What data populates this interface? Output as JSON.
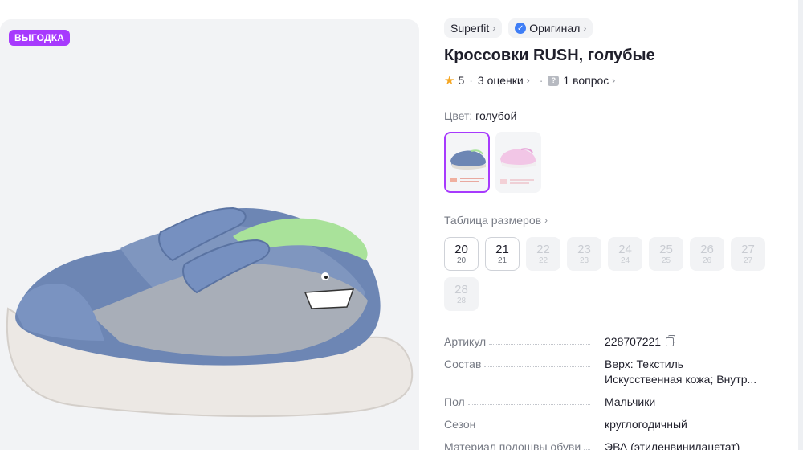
{
  "gallery": {
    "badge": "ВЫГОДКА"
  },
  "chips": {
    "brand": "Superfit",
    "original": "Оригинал"
  },
  "product": {
    "title": "Кроссовки RUSH, голубые"
  },
  "rating": {
    "score": "5",
    "reviews": "3 оценки",
    "questions": "1 вопрос"
  },
  "color": {
    "label": "Цвет:",
    "value": "голубой"
  },
  "sizes": {
    "label": "Таблица размеров",
    "items": [
      {
        "main": "20",
        "sub": "20",
        "available": true
      },
      {
        "main": "21",
        "sub": "21",
        "available": true
      },
      {
        "main": "22",
        "sub": "22",
        "available": false
      },
      {
        "main": "23",
        "sub": "23",
        "available": false
      },
      {
        "main": "24",
        "sub": "24",
        "available": false
      },
      {
        "main": "25",
        "sub": "25",
        "available": false
      },
      {
        "main": "26",
        "sub": "26",
        "available": false
      },
      {
        "main": "27",
        "sub": "27",
        "available": false
      },
      {
        "main": "28",
        "sub": "28",
        "available": false
      }
    ]
  },
  "specs": [
    {
      "key": "Артикул",
      "value": [
        "228707221"
      ]
    },
    {
      "key": "Состав",
      "value": [
        "Верх: Текстиль",
        "Искусственная кожа; Внутр..."
      ]
    },
    {
      "key": "Пол",
      "value": [
        "Мальчики"
      ]
    },
    {
      "key": "Сезон",
      "value": [
        "круглогодичный"
      ]
    },
    {
      "key": "Материал подошвы обуви",
      "value": [
        "ЭВА (этиленвинилацетат)"
      ]
    }
  ],
  "colors": {
    "accent": "#a73afd",
    "star": "#f5a623",
    "verified": "#3f7ef6"
  }
}
